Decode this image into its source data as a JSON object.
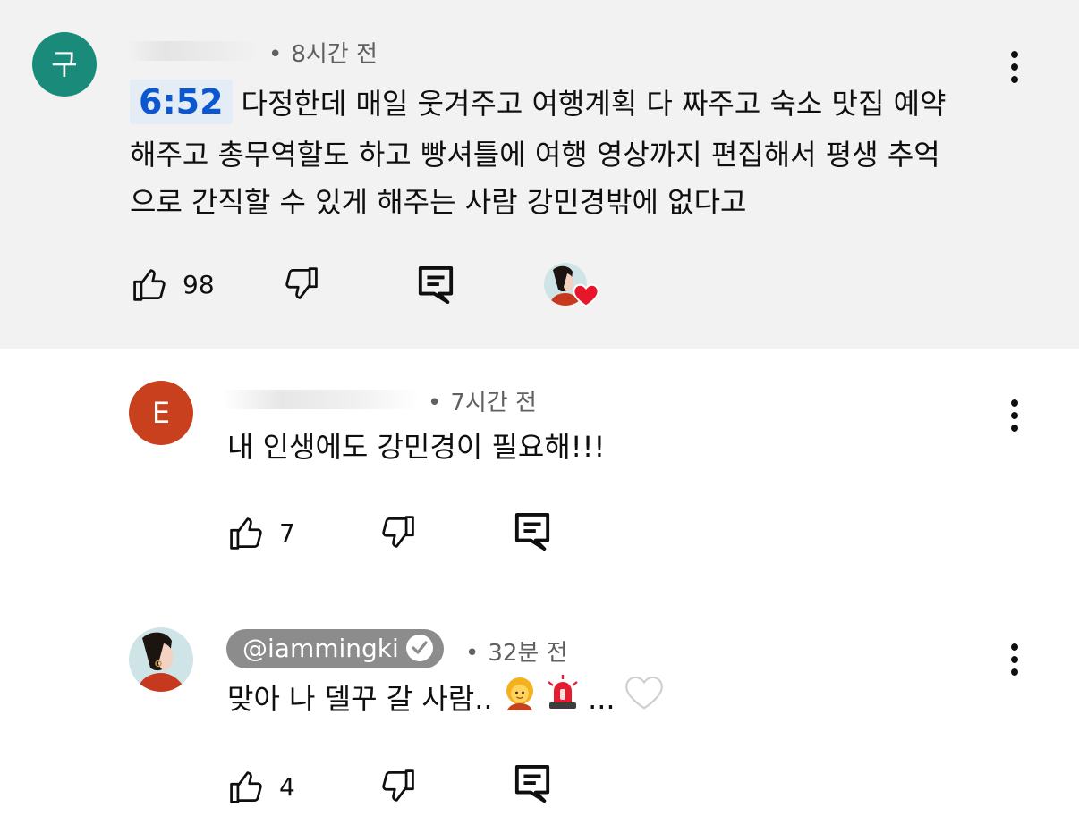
{
  "comments": [
    {
      "avatar_letter": "구",
      "avatar_color": "#1a8a7a",
      "time": "8시간 전",
      "timestamp_link": "6:52",
      "lines": [
        "다정한데 매일 웃겨주고 여행계획 다 짜주고 숙소 맛집 예약",
        "해주고 총무역할도 하고 빵셔틀에 여행 영상까지 편집해서 평생 추억",
        "으로 간직할 수 있게 해주는 사람 강민경밖에 없다고"
      ],
      "likes": "98",
      "creator_heart": true
    },
    {
      "avatar_letter": "E",
      "avatar_color": "#c8401e",
      "time": "7시간 전",
      "text": "내 인생에도 강민경이 필요해!!!",
      "likes": "7"
    },
    {
      "handle": "@iammingki",
      "verified": true,
      "time": "32분 전",
      "text": "맞아 나 델꾸 갈 사람..",
      "text_tail": "...",
      "emojis": [
        "woman-emoji",
        "siren-emoji",
        "white-heart-emoji"
      ],
      "likes": "4"
    }
  ],
  "icons": [
    "like-icon",
    "dislike-icon",
    "reply-icon",
    "more-vert-icon"
  ]
}
